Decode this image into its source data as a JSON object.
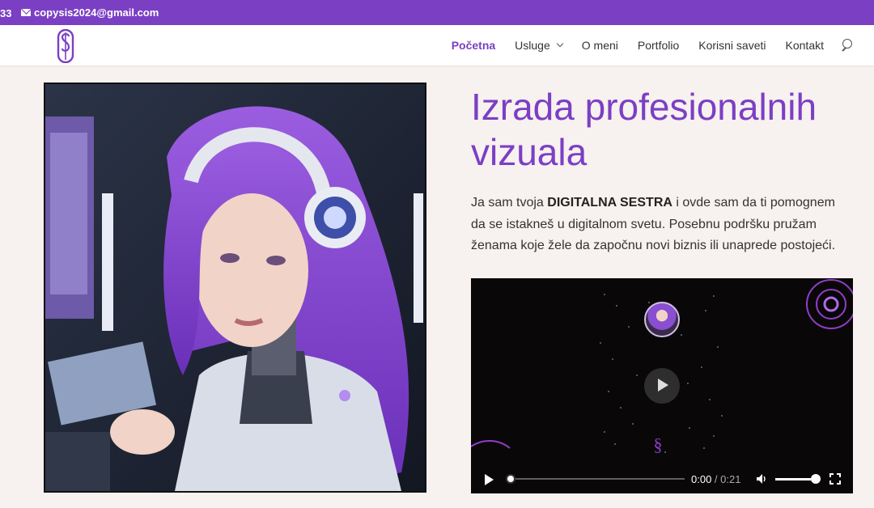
{
  "topbar": {
    "phone_fragment": "33",
    "email": "copysis2024@gmail.com"
  },
  "nav": {
    "items": [
      {
        "label": "Početna",
        "active": true
      },
      {
        "label": "Usluge",
        "has_dropdown": true
      },
      {
        "label": "O meni"
      },
      {
        "label": "Portfolio"
      },
      {
        "label": "Korisni saveti"
      },
      {
        "label": "Kontakt"
      }
    ],
    "search_icon": "search-icon"
  },
  "hero": {
    "image_alt": "Robotic woman with purple hair and headphones",
    "headline": "Izrada profesionalnih vizuala",
    "intro_before": "Ja sam tvoja ",
    "intro_bold": "DIGITALNA SESTRA",
    "intro_after": " i ovde sam da ti pomognem da se istakneš u digitalnom svetu. Posebnu podršku pružam ženama koje žele da započnu novi biznis ili unaprede postojeći."
  },
  "video": {
    "current_time": "0:00",
    "separator": " / ",
    "duration": "0:21",
    "progress": 0,
    "volume": 1.0
  },
  "colors": {
    "accent": "#7b3fc4",
    "background": "#f7f1ef",
    "text": "#333333"
  }
}
